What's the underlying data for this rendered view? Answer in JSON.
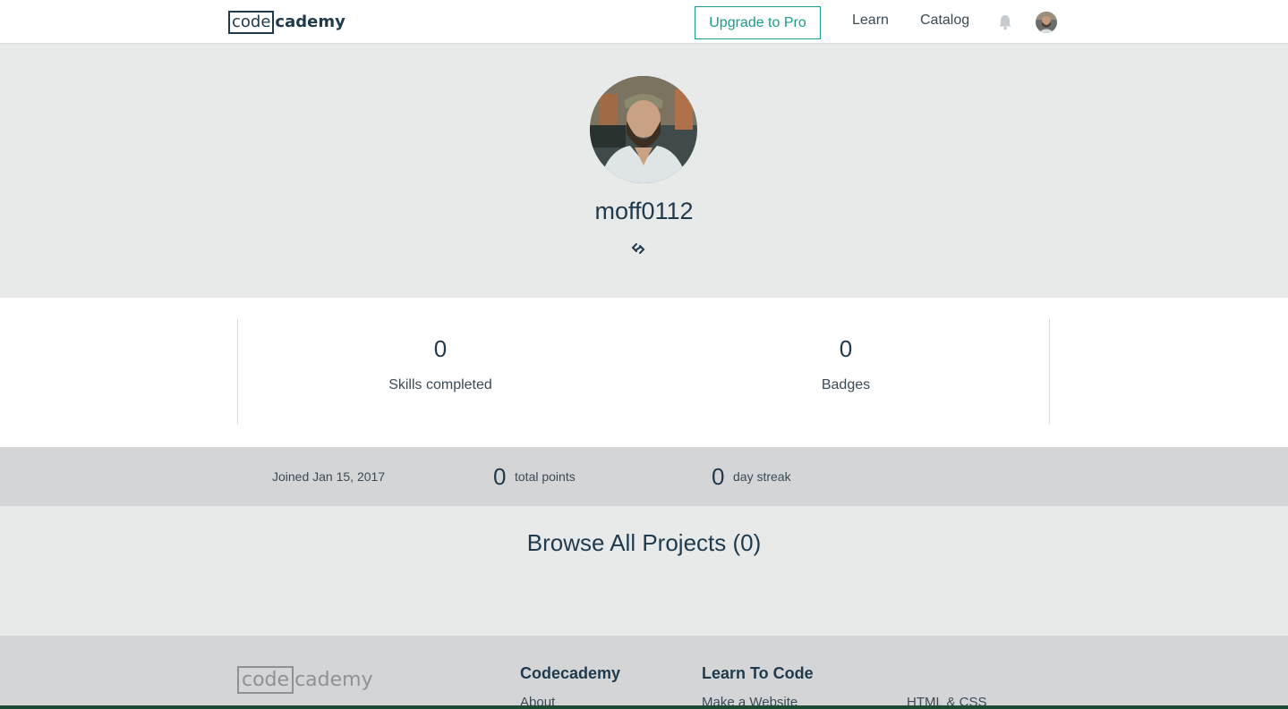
{
  "header": {
    "logo_box": "code",
    "logo_rest": "cademy",
    "upgrade_label": "Upgrade to Pro",
    "nav": [
      "Learn",
      "Catalog"
    ]
  },
  "profile": {
    "username": "moff0112"
  },
  "stats": {
    "skills_value": "0",
    "skills_label": "Skills completed",
    "badges_value": "0",
    "badges_label": "Badges"
  },
  "info": {
    "joined": "Joined Jan 15, 2017",
    "points_value": "0",
    "points_label": "total points",
    "streak_value": "0",
    "streak_label": "day streak"
  },
  "projects": {
    "title": "Browse All Projects (0)"
  },
  "footer": {
    "logo_box": "code",
    "logo_rest": "cademy",
    "headings": [
      "Codecademy",
      "Learn To Code"
    ],
    "links": [
      "About",
      "Make a Website",
      "HTML & CSS"
    ]
  },
  "colors": {
    "accent": "#1b9b8a",
    "text": "#1f3a4d",
    "hero_bg": "#e8e9e9",
    "bar_bg": "#d4d5d7"
  }
}
